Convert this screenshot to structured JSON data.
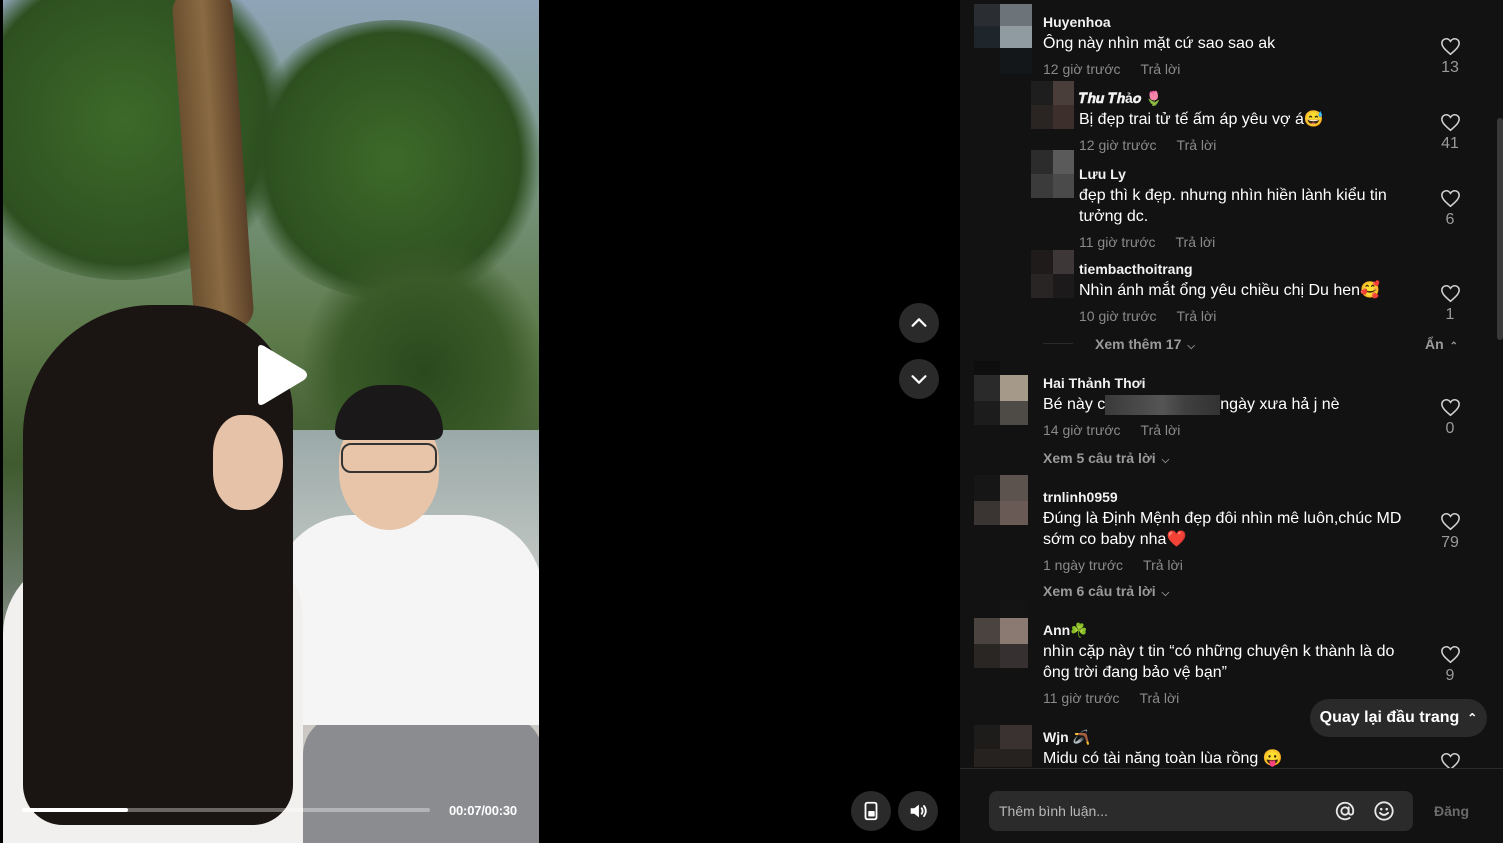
{
  "player": {
    "time": "00:07/00:30",
    "progress_fraction": 0.26
  },
  "comments": [
    {
      "user": "Huyenhoa",
      "text": "Ông này nhìn mặt cứ sao sao ak",
      "time": "12 giờ trước",
      "reply": "Trả lời",
      "likes": "13"
    },
    {
      "user": "𝑻𝒉𝒖 𝑻𝒉ả𝒐 🌷",
      "text": "Bị đẹp trai tử tế ấm áp yêu vợ á😅",
      "time": "12 giờ trước",
      "reply": "Trả lời",
      "likes": "41"
    },
    {
      "user": "Lưu Ly",
      "text": "đẹp thì k đẹp. nhưng nhìn hiền lành kiểu tin tưởng dc.",
      "time": "11 giờ trước",
      "reply": "Trả lời",
      "likes": "6"
    },
    {
      "user": "tiembacthoitrang",
      "text": "Nhìn ánh mắt ổng yêu chiều chị Du hen🥰",
      "time": "10 giờ trước",
      "reply": "Trả lời",
      "likes": "1"
    },
    {
      "user": "Hai Thảnh Thơi",
      "text_before": "Bé này c",
      "text_after": "ngày xưa hả j nè",
      "time": "14 giờ trước",
      "reply": "Trả lời",
      "likes": "0"
    },
    {
      "user": "trnlinh0959",
      "text": "Đúng là Định Mệnh đẹp đôi nhìn mê luôn,chúc MD sớm co baby nha❤️",
      "time": "1 ngày trước",
      "reply": "Trả lời",
      "likes": "79"
    },
    {
      "user": "Ann☘️",
      "text": "nhìn cặp này t tin “có những chuyện k thành là do ông trời đang bảo vệ bạn”",
      "time": "11 giờ trước",
      "reply": "Trả lời",
      "likes": "9"
    },
    {
      "user": "Wjn 🪃",
      "text": "Midu có tài năng toàn lùa rồng 😛"
    }
  ],
  "view_more": {
    "thread1": "Xem thêm 17",
    "hide": "Ẩn",
    "thread2": "Xem 5 câu trả lời",
    "thread3": "Xem 6 câu trả lời"
  },
  "back_to_top": "Quay lại đầu trang",
  "composer": {
    "placeholder": "Thêm bình luận...",
    "post": "Đăng"
  },
  "icons": {
    "play": "play-icon",
    "nav_up": "chevron-up-icon",
    "nav_down": "chevron-down-icon",
    "pip": "picture-in-picture-icon",
    "volume": "volume-icon",
    "heart": "heart-outline-icon",
    "mention": "at-sign-icon",
    "emoji": "emoji-icon"
  }
}
